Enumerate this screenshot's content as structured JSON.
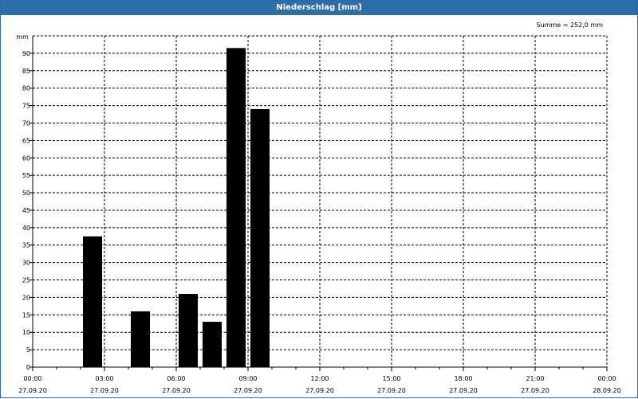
{
  "window": {
    "title": "Niederschlag [mm]"
  },
  "colors": {
    "titlebar": "#2e6ea8",
    "bars": "#000000",
    "grid": "#000000"
  },
  "chart_data": {
    "type": "bar",
    "title": "Niederschlag [mm]",
    "ylabel": "mm",
    "summary": "Summe = 252,0 mm",
    "ylim": [
      0,
      95
    ],
    "yticks": [
      0,
      5,
      10,
      15,
      20,
      25,
      30,
      35,
      40,
      45,
      50,
      55,
      60,
      65,
      70,
      75,
      80,
      85,
      90
    ],
    "xlim": [
      "27.09.20 00:00",
      "28.09.20 00:00"
    ],
    "xticks": [
      {
        "time": "00:00",
        "date": "27.09.20",
        "hour": 0
      },
      {
        "time": "03:00",
        "date": "27.09.20",
        "hour": 3
      },
      {
        "time": "06:00",
        "date": "27.09.20",
        "hour": 6
      },
      {
        "time": "09:00",
        "date": "27.09.20",
        "hour": 9
      },
      {
        "time": "12:00",
        "date": "27.09.20",
        "hour": 12
      },
      {
        "time": "15:00",
        "date": "27.09.20",
        "hour": 15
      },
      {
        "time": "18:00",
        "date": "27.09.20",
        "hour": 18
      },
      {
        "time": "21:00",
        "date": "27.09.20",
        "hour": 21
      },
      {
        "time": "00:00",
        "date": "28.09.20",
        "hour": 24
      }
    ],
    "bars": [
      {
        "start_hour": 2,
        "end_hour": 3,
        "value": 37.5
      },
      {
        "start_hour": 4,
        "end_hour": 5,
        "value": 16
      },
      {
        "start_hour": 6,
        "end_hour": 7,
        "value": 21
      },
      {
        "start_hour": 7,
        "end_hour": 8,
        "value": 13
      },
      {
        "start_hour": 8,
        "end_hour": 9,
        "value": 91.5
      },
      {
        "start_hour": 9,
        "end_hour": 10,
        "value": 74
      }
    ],
    "grid": true
  }
}
